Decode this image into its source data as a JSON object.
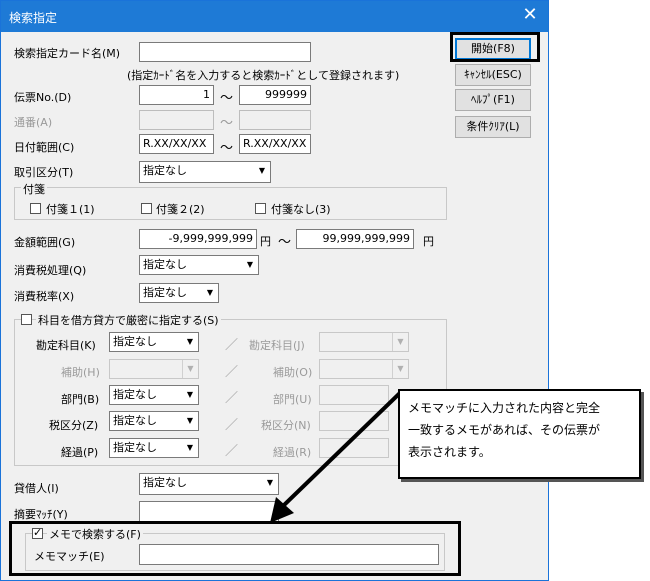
{
  "window": {
    "title": "検索指定",
    "close": "✕"
  },
  "form": {
    "card_name_label": "検索指定カード名(M)",
    "card_name_value": "",
    "card_name_hint": "(指定ｶｰﾄﾞ名を入力すると検索ｶｰﾄﾞとして登録されます)",
    "denpyo_label": "伝票No.(D)",
    "denpyo_from": "1",
    "denpyo_to": "999999",
    "tsuban_label": "通番(A)",
    "tilde": "～",
    "date_label": "日付範囲(C)",
    "date_from": "R.XX/XX/XX",
    "date_to": "R.XX/XX/XX",
    "torihiki_label": "取引区分(T)",
    "torihiki_value": "指定なし",
    "fusen_group": "付箋",
    "fusen1": "付箋１(1)",
    "fusen2": "付箋２(2)",
    "fusen_none": "付箋なし(3)",
    "kingaku_label": "金額範囲(G)",
    "kingaku_from": "-9,999,999,999",
    "kingaku_to": "99,999,999,999",
    "yen": "円",
    "shohizei_label": "消費税処理(Q)",
    "shohizei_value": "指定なし",
    "zeiritsu_label": "消費税率(X)",
    "zeiritsu_value": "指定なし",
    "kamoku_group": "科目を借方貸方で厳密に指定する(S)",
    "kanjo_label": "勘定科目(K)",
    "kanjo_value": "指定なし",
    "kanjo_r_label": "勘定科目(J)",
    "hojo_label": "補助(H)",
    "hojo_r_label": "補助(O)",
    "bumon_label": "部門(B)",
    "bumon_value": "指定なし",
    "bumon_r_label": "部門(U)",
    "zeikubun_label": "税区分(Z)",
    "zeikubun_value": "指定なし",
    "zeikubun_r_label": "税区分(N)",
    "keika_label": "経過(P)",
    "keika_value": "指定なし",
    "keika_r_label": "経過(R)",
    "slash": "／",
    "taishaku_label": "貸借人(I)",
    "taishaku_value": "指定なし",
    "tekiyo_label": "摘要ﾏｯﾁ(Y)",
    "tekiyo_value": "",
    "memo_search_label": "メモで検索する(F)",
    "memo_match_label": "メモマッチ(E)",
    "memo_match_value": ""
  },
  "buttons": {
    "start": "開始(F8)",
    "cancel": "ｷｬﾝｾﾙ(ESC)",
    "help": "ﾍﾙﾌﾟ(F1)",
    "clear": "条件ｸﾘｱ(L)"
  },
  "callout": {
    "line1": "メモマッチに入力された内容と完全",
    "line2": "一致するメモがあれば、その伝票が",
    "line3": "表示されます。"
  }
}
